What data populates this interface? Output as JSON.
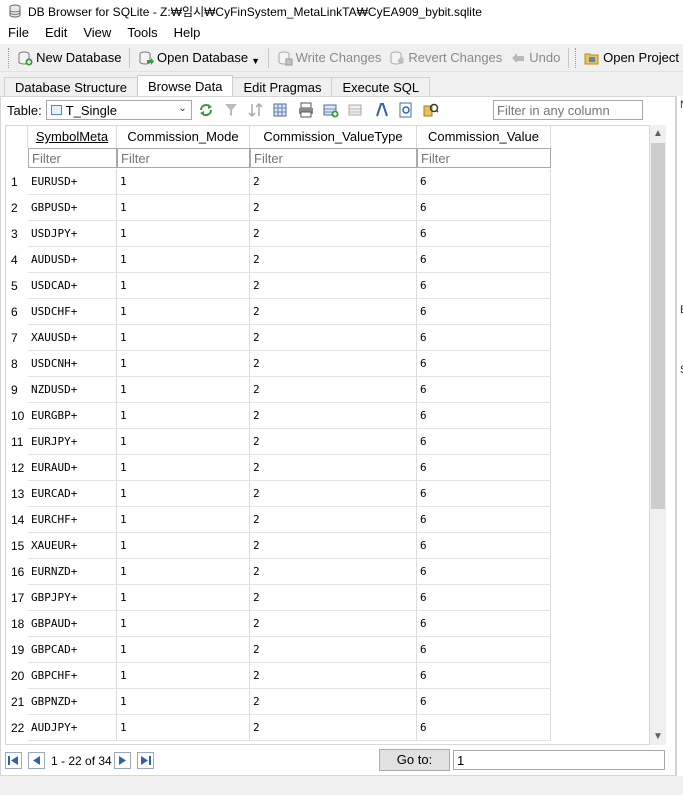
{
  "window": {
    "title": "DB Browser for SQLite - Z:₩임시₩CyFinSystem_MetaLinkTA₩CyEA909_bybit.sqlite"
  },
  "menu": [
    "File",
    "Edit",
    "View",
    "Tools",
    "Help"
  ],
  "toolbar": {
    "new_database": "New Database",
    "open_database": "Open Database",
    "write_changes": "Write Changes",
    "revert_changes": "Revert Changes",
    "undo": "Undo",
    "open_project": "Open Project"
  },
  "tabs": [
    "Database Structure",
    "Browse Data",
    "Edit Pragmas",
    "Execute SQL"
  ],
  "active_tab": "Browse Data",
  "table_selector": {
    "label": "Table:",
    "value": "T_Single"
  },
  "filter_any": {
    "placeholder": "Filter in any column"
  },
  "grid": {
    "columns": [
      "SymbolMeta",
      "Commission_Mode",
      "Commission_ValueType",
      "Commission_Value"
    ],
    "sorted_column": "SymbolMeta",
    "filter_placeholder": "Filter",
    "rows": [
      [
        "1",
        "EURUSD+",
        "1",
        "2",
        "6"
      ],
      [
        "2",
        "GBPUSD+",
        "1",
        "2",
        "6"
      ],
      [
        "3",
        "USDJPY+",
        "1",
        "2",
        "6"
      ],
      [
        "4",
        "AUDUSD+",
        "1",
        "2",
        "6"
      ],
      [
        "5",
        "USDCAD+",
        "1",
        "2",
        "6"
      ],
      [
        "6",
        "USDCHF+",
        "1",
        "2",
        "6"
      ],
      [
        "7",
        "XAUUSD+",
        "1",
        "2",
        "6"
      ],
      [
        "8",
        "USDCNH+",
        "1",
        "2",
        "6"
      ],
      [
        "9",
        "NZDUSD+",
        "1",
        "2",
        "6"
      ],
      [
        "10",
        "EURGBP+",
        "1",
        "2",
        "6"
      ],
      [
        "11",
        "EURJPY+",
        "1",
        "2",
        "6"
      ],
      [
        "12",
        "EURAUD+",
        "1",
        "2",
        "6"
      ],
      [
        "13",
        "EURCAD+",
        "1",
        "2",
        "6"
      ],
      [
        "14",
        "EURCHF+",
        "1",
        "2",
        "6"
      ],
      [
        "15",
        "XAUEUR+",
        "1",
        "2",
        "6"
      ],
      [
        "16",
        "EURNZD+",
        "1",
        "2",
        "6"
      ],
      [
        "17",
        "GBPJPY+",
        "1",
        "2",
        "6"
      ],
      [
        "18",
        "GBPAUD+",
        "1",
        "2",
        "6"
      ],
      [
        "19",
        "GBPCAD+",
        "1",
        "2",
        "6"
      ],
      [
        "20",
        "GBPCHF+",
        "1",
        "2",
        "6"
      ],
      [
        "21",
        "GBPNZD+",
        "1",
        "2",
        "6"
      ],
      [
        "22",
        "AUDJPY+",
        "1",
        "2",
        "6"
      ]
    ]
  },
  "pager": {
    "range_text": "1 - 22 of 34",
    "goto_label": "Go to:",
    "goto_value": "1"
  },
  "right_panel_glyphs": [
    "N",
    "E",
    "S"
  ],
  "icons": {
    "app": "database-icon",
    "new_database": "new-database-icon",
    "open_database": "open-database-icon",
    "write_changes": "write-changes-icon",
    "revert_changes": "revert-changes-icon",
    "undo": "undo-icon",
    "open_project": "open-project-icon"
  }
}
